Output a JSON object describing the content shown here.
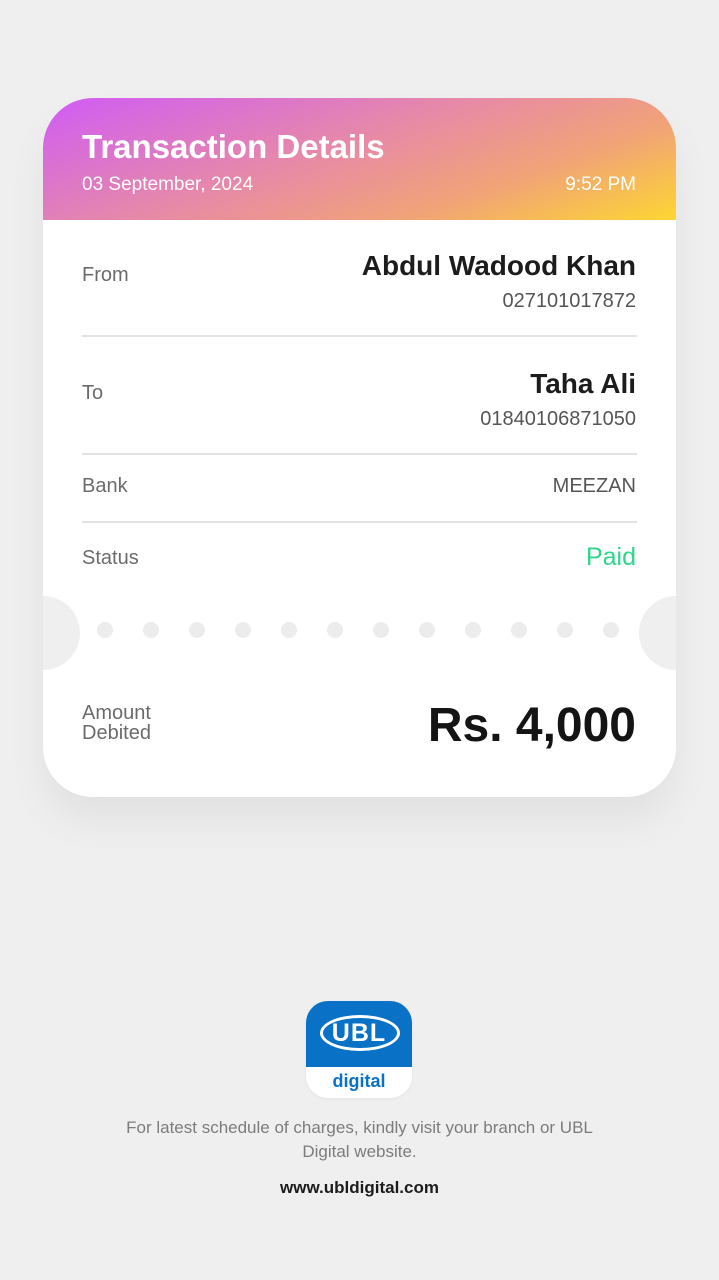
{
  "header": {
    "title": "Transaction Details",
    "date": "03 September, 2024",
    "time": "9:52 PM"
  },
  "from": {
    "label": "From",
    "name": "Abdul Wadood Khan",
    "account": "027101017872"
  },
  "to": {
    "label": "To",
    "name": "Taha Ali",
    "account": "01840106871050"
  },
  "bank": {
    "label": "Bank",
    "value": "MEEZAN"
  },
  "status": {
    "label": "Status",
    "value": "Paid",
    "color": "#2ed68c"
  },
  "amount": {
    "label": "Amount Debited",
    "value": "Rs. 4,000"
  },
  "logo": {
    "name": "UBL",
    "subtitle": "digital",
    "color": "#0a72c6"
  },
  "footer": {
    "note": "For latest schedule of charges, kindly visit your branch or UBL Digital website.",
    "link": "www.ubldigital.com"
  }
}
